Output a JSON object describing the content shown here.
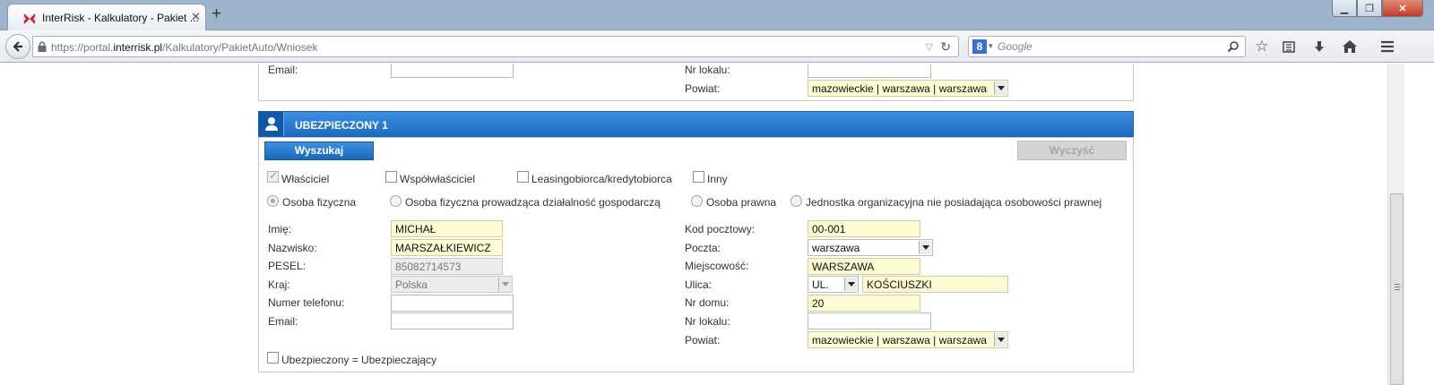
{
  "browser": {
    "tab_title": "InterRisk - Kalkulatory - Pakiet ...",
    "url_prefix": "https://portal.",
    "url_domain": "interrisk.pl",
    "url_path": "/Kalkulatory/PakietAuto/Wniosek",
    "search_placeholder": "Google",
    "search_engine_letter": "8"
  },
  "top_section": {
    "email_label": "Email:",
    "email_value": "",
    "nr_lokalu_label": "Nr lokalu:",
    "nr_lokalu_value": "",
    "powiat_label": "Powiat:",
    "powiat_value": "mazowieckie | warszawa | warszawa"
  },
  "ubezpieczony": {
    "title": "UBEZPIECZONY 1",
    "search_button": "Wyszukaj",
    "clear_button": "Wyczyść",
    "role_checkboxes": [
      {
        "label": "Właściciel",
        "checked": true
      },
      {
        "label": "Współwłaściciel",
        "checked": false
      },
      {
        "label": "Leasingobiorca/kredytobiorca",
        "checked": false
      },
      {
        "label": "Inny",
        "checked": false
      }
    ],
    "person_types": [
      {
        "label": "Osoba fizyczna",
        "checked": true
      },
      {
        "label": "Osoba fizyczna prowadząca działalność gospodarczą",
        "checked": false
      },
      {
        "label": "Osoba prawna",
        "checked": false
      },
      {
        "label": "Jednostka organizacyjna nie posiadająca osobowości prawnej",
        "checked": false
      }
    ],
    "left_fields": {
      "imie_label": "Imię:",
      "imie_value": "MICHAŁ",
      "nazwisko_label": "Nazwisko:",
      "nazwisko_value": "MARSZAŁKIEWICZ",
      "pesel_label": "PESEL:",
      "pesel_value": "85082714573",
      "kraj_label": "Kraj:",
      "kraj_value": "Polska",
      "telefon_label": "Numer telefonu:",
      "telefon_value": "",
      "email_label": "Email:",
      "email_value": ""
    },
    "right_fields": {
      "kod_label": "Kod pocztowy:",
      "kod_value": "00-001",
      "poczta_label": "Poczta:",
      "poczta_value": "warszawa",
      "miejscowosc_label": "Miejscowość:",
      "miejscowosc_value": "WARSZAWA",
      "ulica_label": "Ulica:",
      "ulica_prefix": "UL.",
      "ulica_value": "KOŚCIUSZKI",
      "nr_domu_label": "Nr domu:",
      "nr_domu_value": "20",
      "nr_lokalu_label": "Nr lokalu:",
      "nr_lokalu_value": "",
      "powiat_label": "Powiat:",
      "powiat_value": "mazowieckie | warszawa | warszawa"
    },
    "same_as_label": "Ubezpieczony = Ubezpieczający",
    "same_as_checked": false
  },
  "colors": {
    "header_blue": "#1c6cc5",
    "field_yellow": "#fdfbd2"
  }
}
